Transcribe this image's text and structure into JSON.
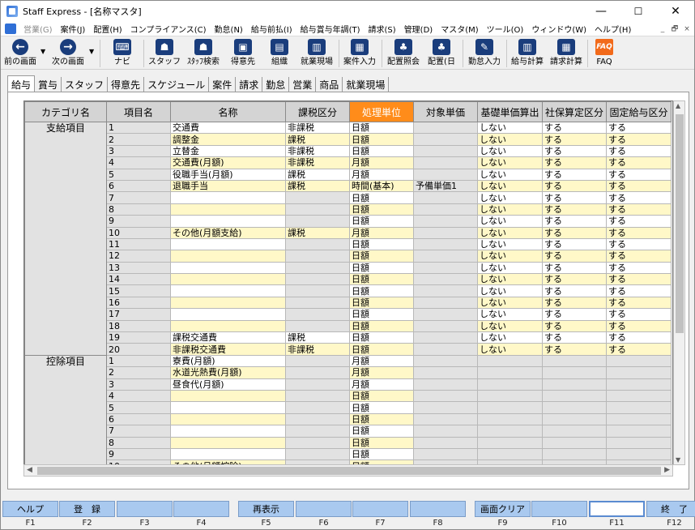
{
  "window": {
    "title": "Staff Express - [名称マスタ]",
    "min": "—",
    "max": "☐",
    "close": "✕"
  },
  "menu": [
    "営業(G)",
    "案件(J)",
    "配置(H)",
    "コンプライアンス(C)",
    "勤怠(N)",
    "給与前払(I)",
    "給与賞与年調(T)",
    "請求(S)",
    "管理(D)",
    "マスタ(M)",
    "ツール(O)",
    "ウィンドウ(W)",
    "ヘルプ(H)"
  ],
  "mdi": {
    "min": "_",
    "restore": "🗗",
    "close": "×"
  },
  "toolbar": {
    "prev": "前の画面",
    "next": "次の画面",
    "navi": "ナビ",
    "staff": "スタッフ",
    "staff_search": "ｽﾀｯﾌ検索",
    "customer": "得意先",
    "org": "組織",
    "worksite": "就業現場",
    "case_input": "案件入力",
    "assign_ref": "配置照会",
    "assign_day": "配置(日",
    "attend_input": "勤怠入力",
    "pay_calc": "給与計算",
    "bill_calc": "請求計算",
    "faq": "FAQ"
  },
  "tabs": [
    "給与",
    "賞与",
    "スタッフ",
    "得意先",
    "スケジュール",
    "案件",
    "請求",
    "勤怠",
    "営業",
    "商品",
    "就業現場"
  ],
  "columns": [
    "カテゴリ名",
    "項目名",
    "名称",
    "課税区分",
    "処理単位",
    "対象単価",
    "基礎単価算出",
    "社保算定区分",
    "固定給与区分"
  ],
  "groups": [
    {
      "category": "支給項目",
      "rows": [
        [
          "1",
          "交通費",
          "非課税",
          "日額",
          "",
          "しない",
          "する",
          "する"
        ],
        [
          "2",
          "調整金",
          "課税",
          "日額",
          "",
          "しない",
          "する",
          "する"
        ],
        [
          "3",
          "立替金",
          "非課税",
          "日額",
          "",
          "しない",
          "する",
          "する"
        ],
        [
          "4",
          "交通費(月額)",
          "非課税",
          "月額",
          "",
          "しない",
          "する",
          "する"
        ],
        [
          "5",
          "役職手当(月額)",
          "課税",
          "月額",
          "",
          "しない",
          "する",
          "する"
        ],
        [
          "6",
          "退職手当",
          "課税",
          "時間(基本)",
          "予備単価1",
          "しない",
          "する",
          "する"
        ],
        [
          "7",
          "",
          "",
          "日額",
          "",
          "しない",
          "する",
          "する"
        ],
        [
          "8",
          "",
          "",
          "日額",
          "",
          "しない",
          "する",
          "する"
        ],
        [
          "9",
          "",
          "",
          "日額",
          "",
          "しない",
          "する",
          "する"
        ],
        [
          "10",
          "その他(月額支給)",
          "課税",
          "月額",
          "",
          "しない",
          "する",
          "する"
        ],
        [
          "11",
          "",
          "",
          "日額",
          "",
          "しない",
          "する",
          "する"
        ],
        [
          "12",
          "",
          "",
          "日額",
          "",
          "しない",
          "する",
          "する"
        ],
        [
          "13",
          "",
          "",
          "日額",
          "",
          "しない",
          "する",
          "する"
        ],
        [
          "14",
          "",
          "",
          "日額",
          "",
          "しない",
          "する",
          "する"
        ],
        [
          "15",
          "",
          "",
          "日額",
          "",
          "しない",
          "する",
          "する"
        ],
        [
          "16",
          "",
          "",
          "日額",
          "",
          "しない",
          "する",
          "する"
        ],
        [
          "17",
          "",
          "",
          "日額",
          "",
          "しない",
          "する",
          "する"
        ],
        [
          "18",
          "",
          "",
          "日額",
          "",
          "しない",
          "する",
          "する"
        ],
        [
          "19",
          "課税交通費",
          "課税",
          "日額",
          "",
          "しない",
          "する",
          "する"
        ],
        [
          "20",
          "非課税交通費",
          "非課税",
          "日額",
          "",
          "しない",
          "する",
          "する"
        ]
      ]
    },
    {
      "category": "控除項目",
      "rows": [
        [
          "1",
          "寮費(月額)",
          "",
          "月額",
          "",
          "",
          "",
          ""
        ],
        [
          "2",
          "水道光熱費(月額)",
          "",
          "月額",
          "",
          "",
          "",
          ""
        ],
        [
          "3",
          "昼食代(月額)",
          "",
          "月額",
          "",
          "",
          "",
          ""
        ],
        [
          "4",
          "",
          "",
          "日額",
          "",
          "",
          "",
          ""
        ],
        [
          "5",
          "",
          "",
          "日額",
          "",
          "",
          "",
          ""
        ],
        [
          "6",
          "",
          "",
          "日額",
          "",
          "",
          "",
          ""
        ],
        [
          "7",
          "",
          "",
          "日額",
          "",
          "",
          "",
          ""
        ],
        [
          "8",
          "",
          "",
          "日額",
          "",
          "",
          "",
          ""
        ],
        [
          "9",
          "",
          "",
          "日額",
          "",
          "",
          "",
          ""
        ],
        [
          "10",
          "その他(月額控除)",
          "",
          "日額",
          "",
          "",
          "",
          ""
        ]
      ]
    }
  ],
  "fkeys": [
    {
      "label": "ヘルプ",
      "key": "F1"
    },
    {
      "label": "登　録",
      "key": "F2"
    },
    {
      "label": "",
      "key": "F3"
    },
    {
      "label": "",
      "key": "F4"
    },
    {
      "label": "再表示",
      "key": "F5"
    },
    {
      "label": "",
      "key": "F6"
    },
    {
      "label": "",
      "key": "F7"
    },
    {
      "label": "",
      "key": "F8"
    },
    {
      "label": "画面クリア",
      "key": "F9"
    },
    {
      "label": "",
      "key": "F10"
    },
    {
      "label": "",
      "key": "F11"
    },
    {
      "label": "終　了",
      "key": "F12"
    }
  ],
  "colors": {
    "header_highlight": "#ff8c1a",
    "row_alt": "#fff8c8",
    "fkey": "#a9c9ef"
  }
}
